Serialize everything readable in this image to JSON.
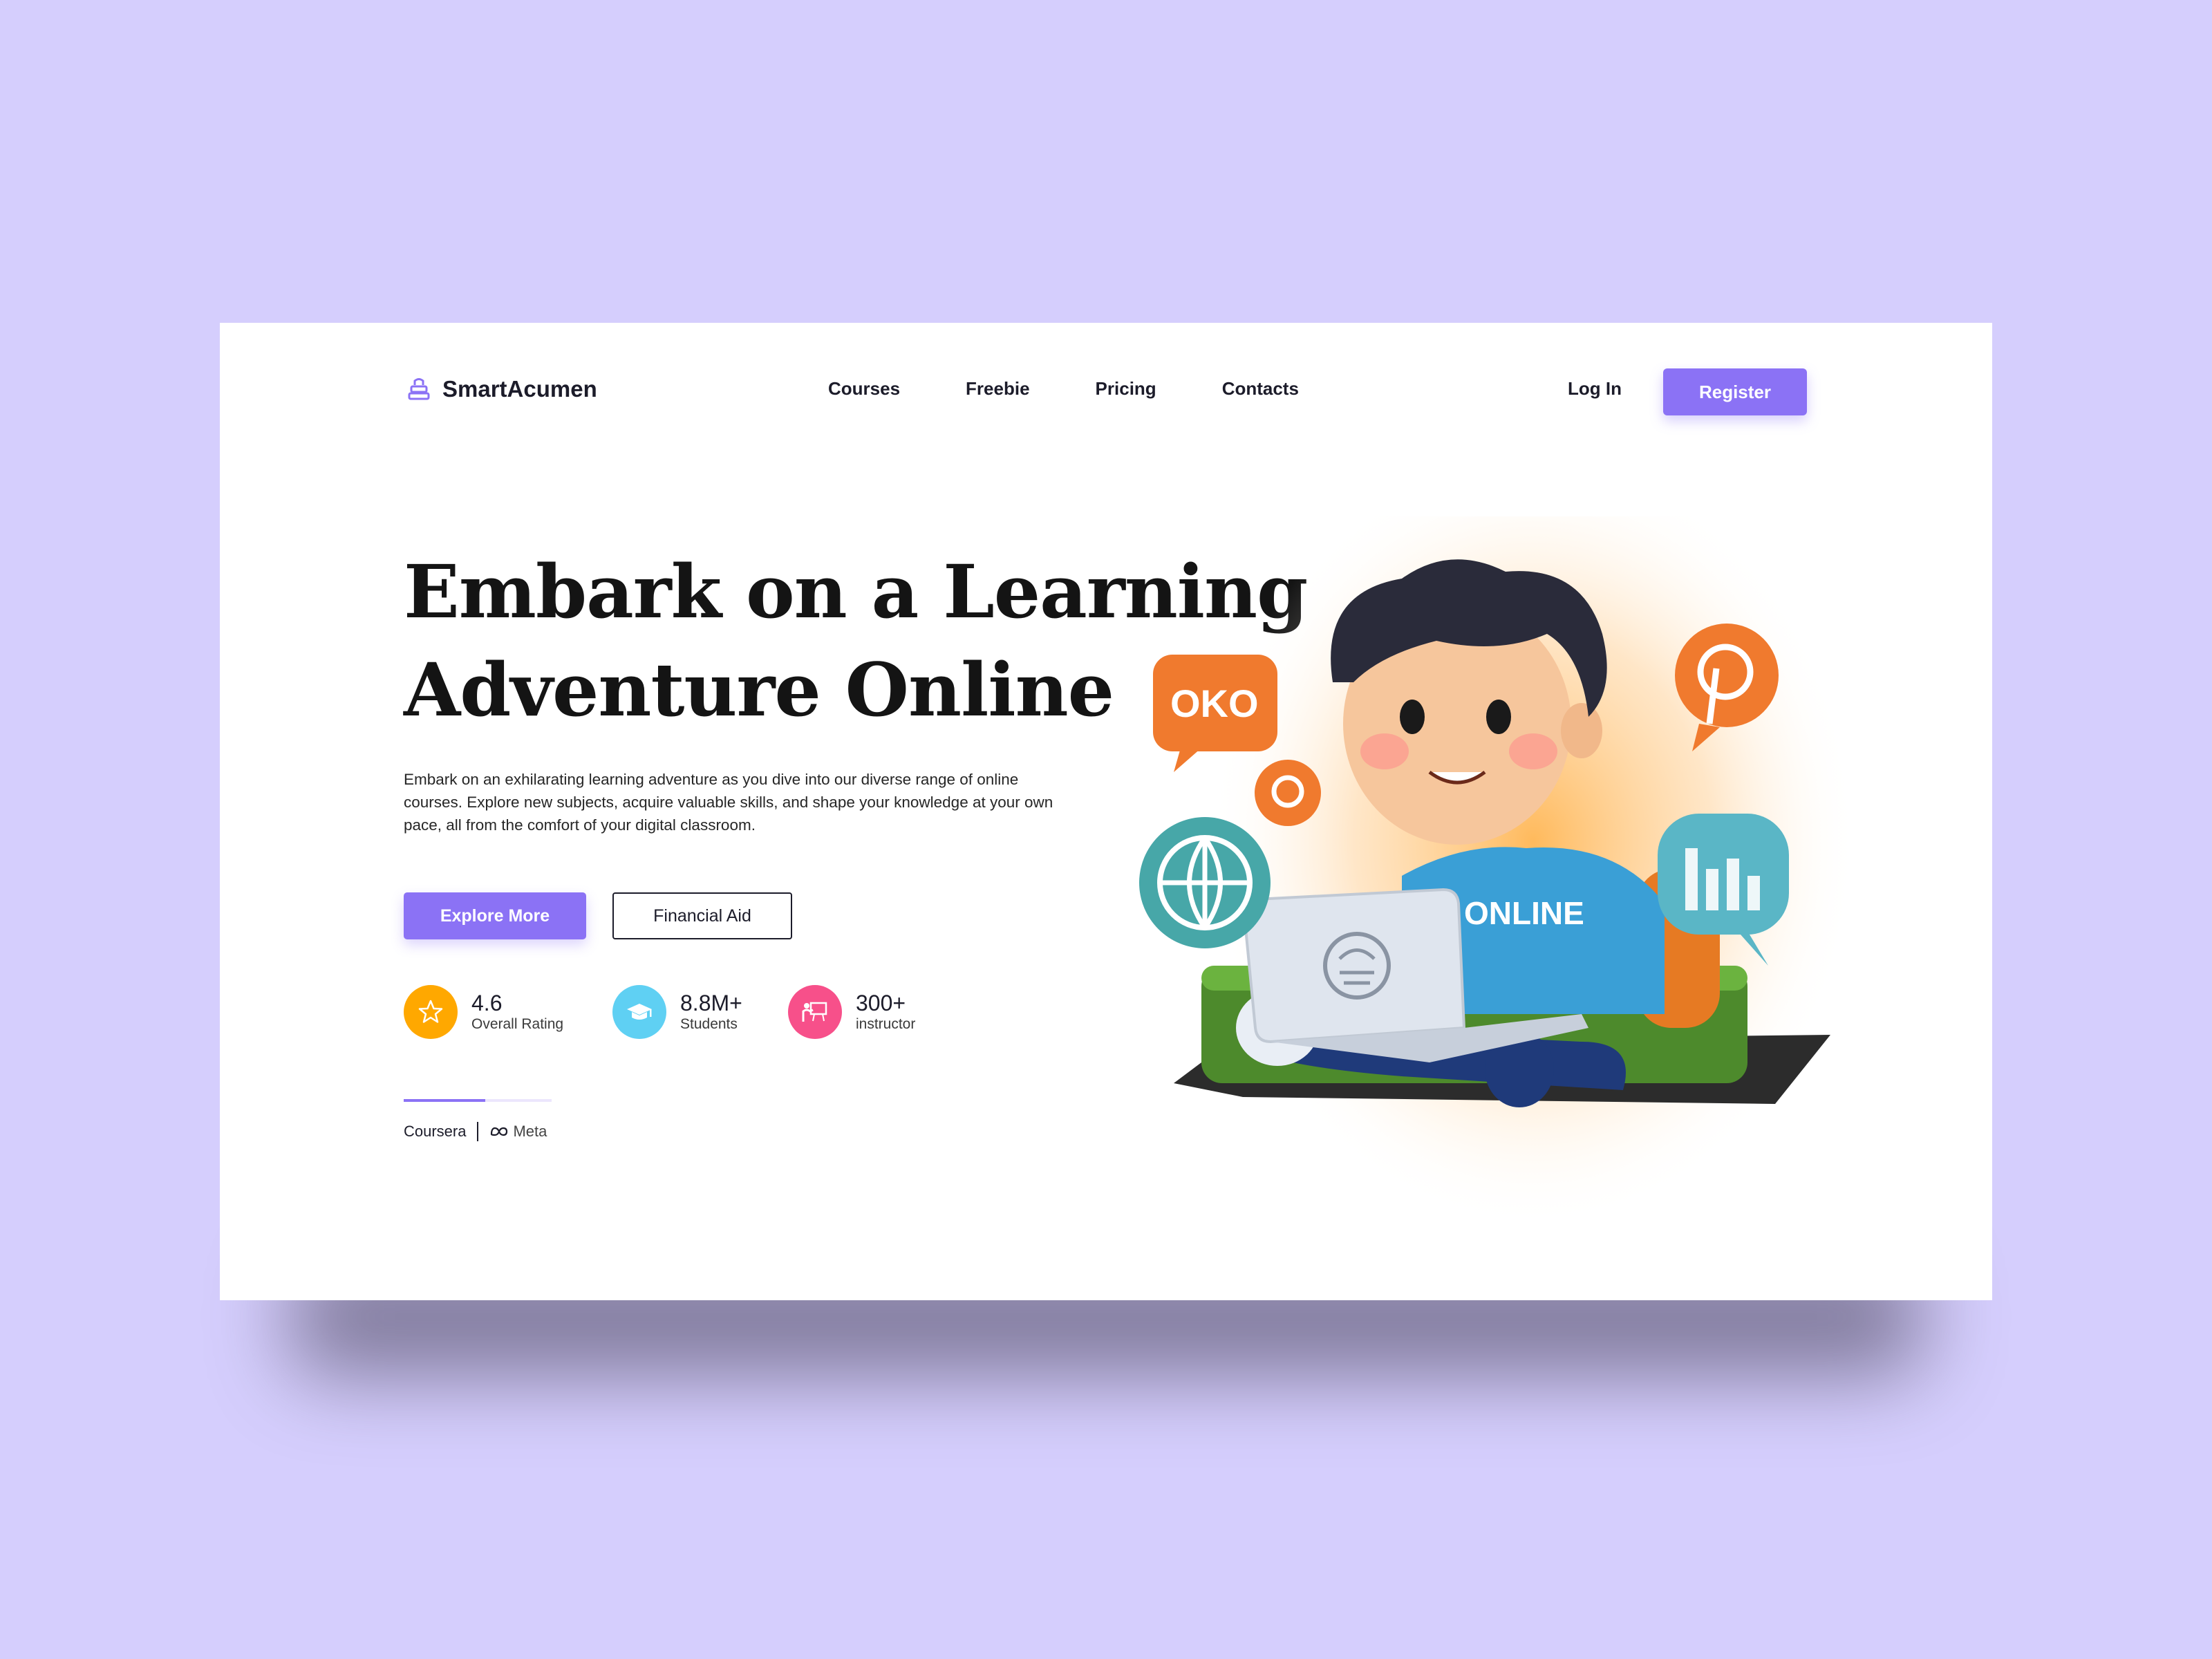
{
  "brand": {
    "name": "SmartAcumen",
    "accent": "#8b72f5",
    "background": "#d5cefd"
  },
  "nav": {
    "items": [
      "Courses",
      "Freebie",
      "Pricing",
      "Contacts"
    ],
    "login": "Log In",
    "register": "Register"
  },
  "hero": {
    "headline_line1": "Embark on a Learning",
    "headline_line2": "Adventure Online",
    "description": "Embark on an exhilarating learning adventure as you dive into our diverse range of online courses. Explore new subjects, acquire valuable skills, and shape your knowledge at your own pace, all from the comfort of your digital classroom.",
    "primary_button": "Explore More",
    "secondary_button": "Financial Aid"
  },
  "stats": [
    {
      "value": "4.6",
      "label": "Overall Rating",
      "icon": "star-icon",
      "color": "#ffa800"
    },
    {
      "value": "8.8M+",
      "label": "Students",
      "icon": "graduation-cap-icon",
      "color": "#5fd0f3"
    },
    {
      "value": "300+",
      "label": "instructor",
      "icon": "teacher-board-icon",
      "color": "#f7508a"
    }
  ],
  "partners": {
    "progress": 0.55,
    "items": [
      "Coursera",
      "Meta"
    ]
  },
  "illustration": {
    "shirt_text": "ONLINE",
    "bubble_text": "OKO"
  }
}
